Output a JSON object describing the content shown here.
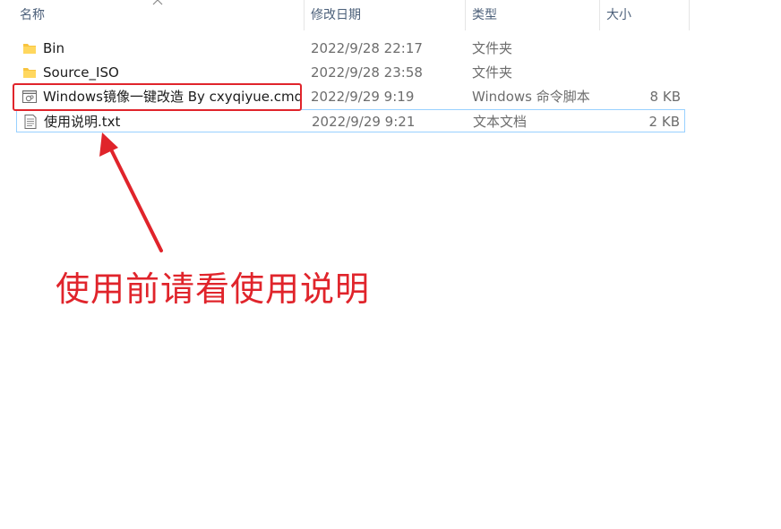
{
  "columns": {
    "name": "名称",
    "date_modified": "修改日期",
    "type": "类型",
    "size": "大小"
  },
  "sort": {
    "column": "name",
    "direction": "ascending",
    "icon": "chevron-up-icon"
  },
  "files": [
    {
      "name": "Bin",
      "date": "2022/9/28 22:17",
      "type": "文件夹",
      "size": "",
      "icon": "folder-icon"
    },
    {
      "name": "Source_ISO",
      "date": "2022/9/28 23:58",
      "type": "文件夹",
      "size": "",
      "icon": "folder-icon"
    },
    {
      "name": "Windows镜像一键改造 By cxyqiyue.cmd",
      "date": "2022/9/29 9:19",
      "type": "Windows 命令脚本",
      "size": "8 KB",
      "icon": "cmd-script-icon"
    },
    {
      "name": "使用说明.txt",
      "date": "2022/9/29 9:21",
      "type": "文本文档",
      "size": "2 KB",
      "icon": "text-document-icon",
      "selected": true
    }
  ],
  "annotation": {
    "text": "使用前请看使用说明",
    "color": "#e0242b"
  },
  "colors": {
    "folder": "#f8c43f",
    "selection_border": "#99d1ff",
    "annotation_red": "#e0242b",
    "header_text": "#4c607a"
  }
}
